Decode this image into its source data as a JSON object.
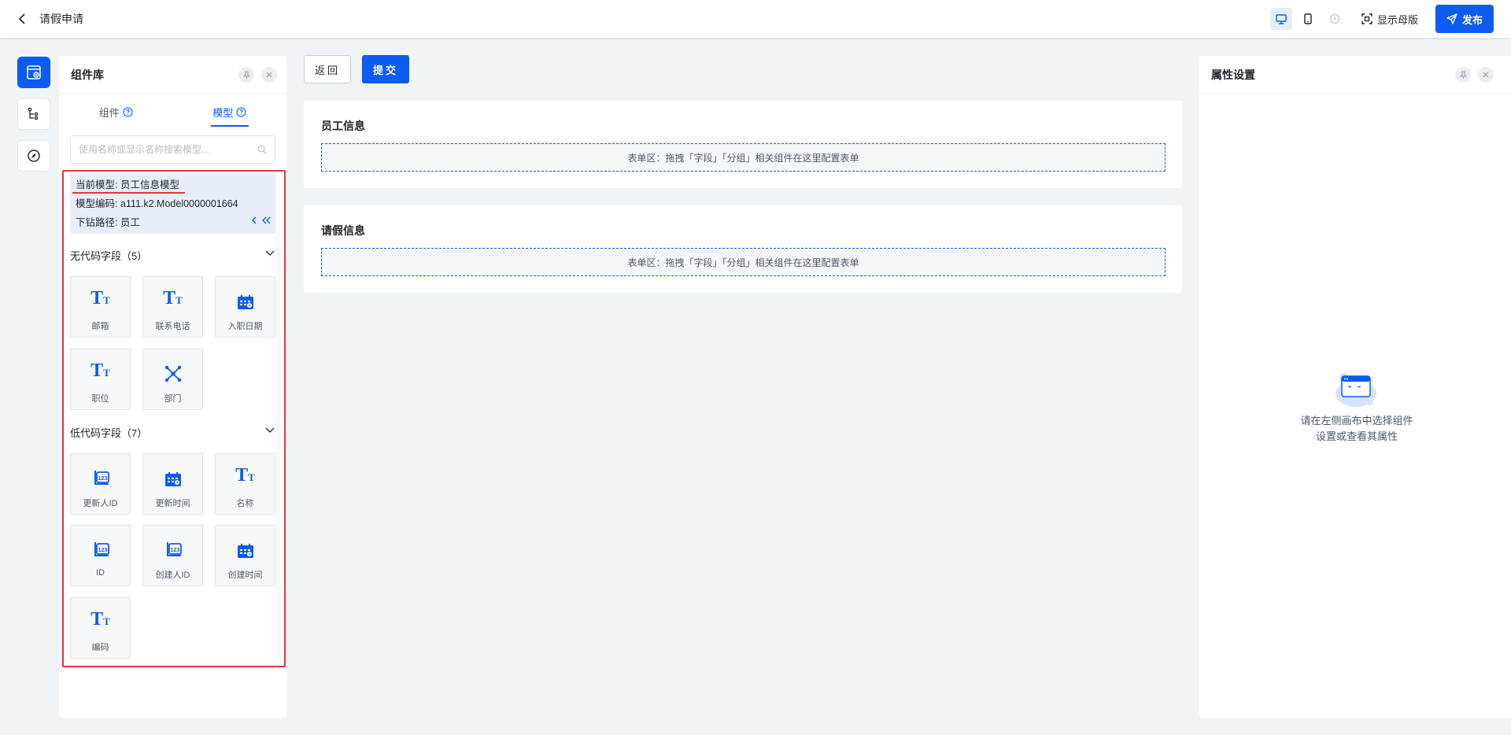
{
  "header": {
    "title": "请假申请",
    "master_label": "显示母版",
    "publish_label": "发布"
  },
  "left_panel": {
    "title": "组件库",
    "tabs": [
      {
        "label": "组件"
      },
      {
        "label": "模型"
      }
    ],
    "search_placeholder": "使用名称或显示名称搜索模型...",
    "model": {
      "current": "当前模型: 员工信息模型",
      "code": "模型编码: a111.k2.Model0000001664",
      "path": "下钻路径: 员工"
    },
    "no_code": {
      "title": "无代码字段（5）",
      "items": [
        {
          "label": "邮箱",
          "icon": "text-type-icon"
        },
        {
          "label": "联系电话",
          "icon": "text-type-icon"
        },
        {
          "label": "入职日期",
          "icon": "calendar-icon"
        },
        {
          "label": "职位",
          "icon": "text-type-icon"
        },
        {
          "label": "部门",
          "icon": "org-tree-icon"
        }
      ]
    },
    "low_code": {
      "title": "低代码字段（7）",
      "items": [
        {
          "label": "更新人ID",
          "icon": "number-icon"
        },
        {
          "label": "更新时间",
          "icon": "calendar-icon"
        },
        {
          "label": "名称",
          "icon": "text-type-icon"
        },
        {
          "label": "ID",
          "icon": "number-icon"
        },
        {
          "label": "创建人ID",
          "icon": "number-icon"
        },
        {
          "label": "创建时间",
          "icon": "calendar-icon"
        },
        {
          "label": "编码",
          "icon": "text-type-icon"
        }
      ]
    }
  },
  "canvas": {
    "back_label": "返回",
    "submit_label": "提交",
    "sections": [
      {
        "title": "员工信息",
        "drop_hint": "表单区：拖拽「字段」「分组」相关组件在这里配置表单"
      },
      {
        "title": "请假信息",
        "drop_hint": "表单区：拖拽「字段」「分组」相关组件在这里配置表单"
      }
    ]
  },
  "right_panel": {
    "title": "属性设置",
    "empty_line1": "请在左侧画布中选择组件",
    "empty_line2": "设置或查看其属性"
  },
  "colors": {
    "accent": "#0c5bf3",
    "highlight": "#e8333b"
  }
}
